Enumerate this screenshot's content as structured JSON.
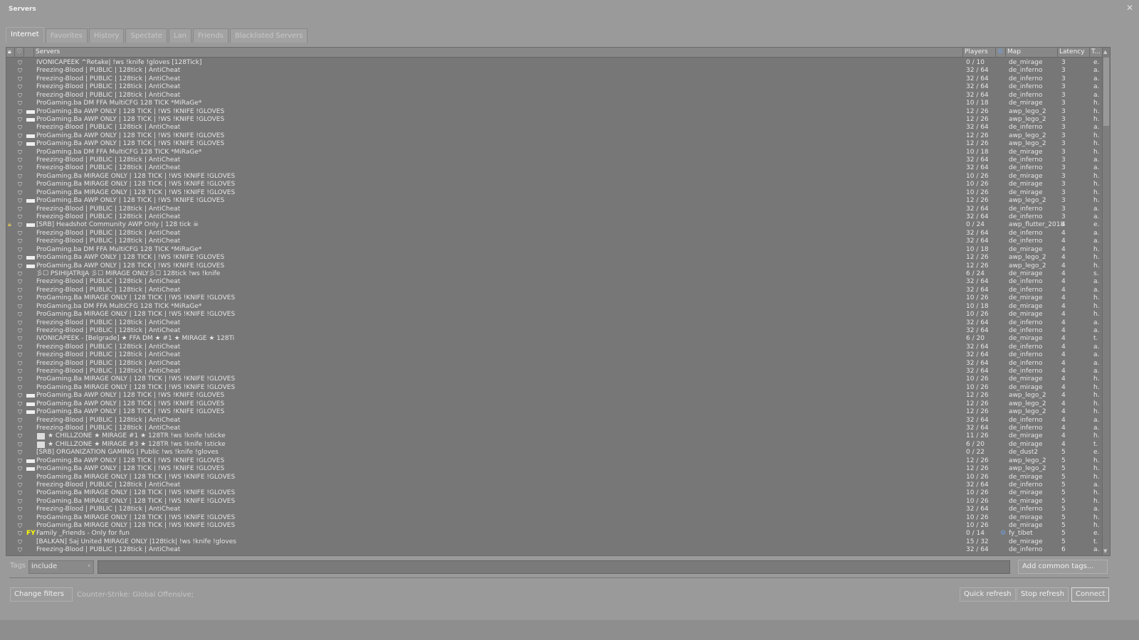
{
  "window": {
    "title": "Servers",
    "close_icon": "close-icon"
  },
  "tabs": [
    "Internet",
    "Favorites",
    "History",
    "Spectate",
    "Lan",
    "Friends",
    "Blacklisted Servers"
  ],
  "active_tab": "Internet",
  "columns": {
    "servers": "Servers",
    "players": "Players",
    "map": "Map",
    "latency": "Latency",
    "tags": "T..."
  },
  "rows": [
    [
      "",
      "IVONICAPEEK ^Retake| !ws !knife !gloves [128Tick]",
      "0 / 10",
      "de_mirage",
      "3",
      "e."
    ],
    [
      "",
      "Freezing-Blood | PUBLIC | 128tick | AntiCheat",
      "32 / 64",
      "de_inferno",
      "3",
      "a."
    ],
    [
      "",
      "Freezing-Blood | PUBLIC | 128tick | AntiCheat",
      "32 / 64",
      "de_inferno",
      "3",
      "a."
    ],
    [
      "",
      "Freezing-Blood | PUBLIC | 128tick | AntiCheat",
      "32 / 64",
      "de_inferno",
      "3",
      "a."
    ],
    [
      "",
      "Freezing-Blood | PUBLIC | 128tick | AntiCheat",
      "32 / 64",
      "de_inferno",
      "3",
      "a."
    ],
    [
      "",
      "ProGaming.ba DM FFA MultiCFG 128 TICK *MiRaGe*",
      "10 / 18",
      "de_mirage",
      "3",
      "h."
    ],
    [
      "awp",
      "ProGaming.Ba AWP ONLY | 128 TICK | !WS !KNIFE !GLOVES",
      "12 / 26",
      "awp_lego_2",
      "3",
      "h."
    ],
    [
      "awp",
      "ProGaming.Ba AWP ONLY | 128 TICK | !WS !KNIFE !GLOVES",
      "12 / 26",
      "awp_lego_2",
      "3",
      "h."
    ],
    [
      "",
      "Freezing-Blood | PUBLIC | 128tick | AntiCheat",
      "32 / 64",
      "de_inferno",
      "3",
      "a."
    ],
    [
      "awp",
      "ProGaming.Ba AWP ONLY | 128 TICK | !WS !KNIFE !GLOVES",
      "12 / 26",
      "awp_lego_2",
      "3",
      "h."
    ],
    [
      "awp",
      "ProGaming.Ba AWP ONLY | 128 TICK | !WS !KNIFE !GLOVES",
      "12 / 26",
      "awp_lego_2",
      "3",
      "h."
    ],
    [
      "",
      "ProGaming.ba DM FFA MultiCFG 128 TICK *MiRaGe*",
      "10 / 18",
      "de_mirage",
      "3",
      "h."
    ],
    [
      "",
      "Freezing-Blood | PUBLIC | 128tick | AntiCheat",
      "32 / 64",
      "de_inferno",
      "3",
      "a."
    ],
    [
      "",
      "Freezing-Blood | PUBLIC | 128tick | AntiCheat",
      "32 / 64",
      "de_inferno",
      "3",
      "a."
    ],
    [
      "",
      "ProGaming.Ba MIRAGE ONLY | 128 TICK | !WS !KNIFE !GLOVES",
      "10 / 26",
      "de_mirage",
      "3",
      "h."
    ],
    [
      "",
      "ProGaming.Ba MIRAGE ONLY | 128 TICK | !WS !KNIFE !GLOVES",
      "10 / 26",
      "de_mirage",
      "3",
      "h."
    ],
    [
      "",
      "ProGaming.Ba MIRAGE ONLY | 128 TICK | !WS !KNIFE !GLOVES",
      "10 / 26",
      "de_mirage",
      "3",
      "h."
    ],
    [
      "awp",
      "ProGaming.Ba AWP ONLY | 128 TICK | !WS !KNIFE !GLOVES",
      "12 / 26",
      "awp_lego_2",
      "3",
      "h."
    ],
    [
      "",
      "Freezing-Blood | PUBLIC | 128tick | AntiCheat",
      "32 / 64",
      "de_inferno",
      "3",
      "a."
    ],
    [
      "",
      "Freezing-Blood | PUBLIC | 128tick | AntiCheat",
      "32 / 64",
      "de_inferno",
      "3",
      "a."
    ],
    [
      "awp",
      "[SRB] Headshot Community AWP Only | 128 tick ☠",
      "0 / 24",
      "awp_flutter_2018",
      "4",
      "e.",
      "lock"
    ],
    [
      "",
      "Freezing-Blood | PUBLIC | 128tick | AntiCheat",
      "32 / 64",
      "de_inferno",
      "4",
      "a."
    ],
    [
      "",
      "Freezing-Blood | PUBLIC | 128tick | AntiCheat",
      "32 / 64",
      "de_inferno",
      "4",
      "a."
    ],
    [
      "",
      "ProGaming.ba DM FFA MultiCFG 128 TICK *MiRaGe*",
      "10 / 18",
      "de_mirage",
      "4",
      "h."
    ],
    [
      "awp",
      "ProGaming.Ba AWP ONLY | 128 TICK | !WS !KNIFE !GLOVES",
      "12 / 26",
      "awp_lego_2",
      "4",
      "h."
    ],
    [
      "awp",
      "ProGaming.Ba AWP ONLY | 128 TICK | !WS !KNIFE !GLOVES",
      "12 / 26",
      "awp_lego_2",
      "4",
      "h."
    ],
    [
      "",
      "彡☐ PSIHIJATRIJA 彡☐ MIRAGE ONLY彡☐ 128tick !ws !knife",
      "6 / 24",
      "de_mirage",
      "4",
      "s."
    ],
    [
      "",
      "Freezing-Blood | PUBLIC | 128tick | AntiCheat",
      "32 / 64",
      "de_inferno",
      "4",
      "a."
    ],
    [
      "",
      "Freezing-Blood | PUBLIC | 128tick | AntiCheat",
      "32 / 64",
      "de_inferno",
      "4",
      "a."
    ],
    [
      "",
      "ProGaming.Ba MIRAGE ONLY | 128 TICK | !WS !KNIFE !GLOVES",
      "10 / 26",
      "de_mirage",
      "4",
      "h."
    ],
    [
      "",
      "ProGaming.ba DM FFA MultiCFG 128 TICK *MiRaGe*",
      "10 / 18",
      "de_mirage",
      "4",
      "h."
    ],
    [
      "",
      "ProGaming.Ba MIRAGE ONLY | 128 TICK | !WS !KNIFE !GLOVES",
      "10 / 26",
      "de_mirage",
      "4",
      "h."
    ],
    [
      "",
      "Freezing-Blood | PUBLIC | 128tick | AntiCheat",
      "32 / 64",
      "de_inferno",
      "4",
      "a."
    ],
    [
      "",
      "Freezing-Blood | PUBLIC | 128tick | AntiCheat",
      "32 / 64",
      "de_inferno",
      "4",
      "a."
    ],
    [
      "",
      "IVONICAPEEK - [Belgrade] ★ FFA DM ★ #1 ★ MIRAGE ★ 128Ti",
      "6 / 20",
      "de_mirage",
      "4",
      "t."
    ],
    [
      "",
      "Freezing-Blood | PUBLIC | 128tick | AntiCheat",
      "32 / 64",
      "de_inferno",
      "4",
      "a."
    ],
    [
      "",
      "Freezing-Blood | PUBLIC | 128tick | AntiCheat",
      "32 / 64",
      "de_inferno",
      "4",
      "a."
    ],
    [
      "",
      "Freezing-Blood | PUBLIC | 128tick | AntiCheat",
      "32 / 64",
      "de_inferno",
      "4",
      "a."
    ],
    [
      "",
      "Freezing-Blood | PUBLIC | 128tick | AntiCheat",
      "32 / 64",
      "de_inferno",
      "4",
      "a."
    ],
    [
      "",
      "ProGaming.Ba MIRAGE ONLY | 128 TICK | !WS !KNIFE !GLOVES",
      "10 / 26",
      "de_mirage",
      "4",
      "h."
    ],
    [
      "",
      "ProGaming.Ba MIRAGE ONLY | 128 TICK | !WS !KNIFE !GLOVES",
      "10 / 26",
      "de_mirage",
      "4",
      "h."
    ],
    [
      "awp",
      "ProGaming.Ba AWP ONLY | 128 TICK | !WS !KNIFE !GLOVES",
      "12 / 26",
      "awp_lego_2",
      "4",
      "h."
    ],
    [
      "awp",
      "ProGaming.Ba AWP ONLY | 128 TICK | !WS !KNIFE !GLOVES",
      "12 / 26",
      "awp_lego_2",
      "4",
      "h."
    ],
    [
      "awp",
      "ProGaming.Ba AWP ONLY | 128 TICK | !WS !KNIFE !GLOVES",
      "12 / 26",
      "awp_lego_2",
      "4",
      "h."
    ],
    [
      "",
      "Freezing-Blood | PUBLIC | 128tick | AntiCheat",
      "32 / 64",
      "de_inferno",
      "4",
      "a."
    ],
    [
      "",
      "Freezing-Blood | PUBLIC | 128tick | AntiCheat",
      "32 / 64",
      "de_inferno",
      "4",
      "a."
    ],
    [
      "sq",
      "★ CHILLZONE ★ MIRAGE #1 ★ 128TR !ws !knife !sticke",
      "11 / 26",
      "de_mirage",
      "4",
      "h."
    ],
    [
      "sq",
      "★ CHILLZONE ★ MIRAGE #3 ★ 128TR !ws !knife !sticke",
      "6 / 20",
      "de_mirage",
      "4",
      "t."
    ],
    [
      "",
      "[SRB] ORGANIZATION GAMING | Public !ws !knife !gloves",
      "0 / 22",
      "de_dust2",
      "5",
      "e."
    ],
    [
      "awp",
      "ProGaming.Ba AWP ONLY | 128 TICK | !WS !KNIFE !GLOVES",
      "12 / 26",
      "awp_lego_2",
      "5",
      "h."
    ],
    [
      "awp",
      "ProGaming.Ba AWP ONLY | 128 TICK | !WS !KNIFE !GLOVES",
      "12 / 26",
      "awp_lego_2",
      "5",
      "h."
    ],
    [
      "",
      "ProGaming.Ba MIRAGE ONLY | 128 TICK | !WS !KNIFE !GLOVES",
      "10 / 26",
      "de_mirage",
      "5",
      "h."
    ],
    [
      "",
      "Freezing-Blood | PUBLIC | 128tick | AntiCheat",
      "32 / 64",
      "de_inferno",
      "5",
      "a."
    ],
    [
      "",
      "ProGaming.Ba MIRAGE ONLY | 128 TICK | !WS !KNIFE !GLOVES",
      "10 / 26",
      "de_mirage",
      "5",
      "h."
    ],
    [
      "",
      "ProGaming.Ba MIRAGE ONLY | 128 TICK | !WS !KNIFE !GLOVES",
      "10 / 26",
      "de_mirage",
      "5",
      "h."
    ],
    [
      "",
      "Freezing-Blood | PUBLIC | 128tick | AntiCheat",
      "32 / 64",
      "de_inferno",
      "5",
      "a."
    ],
    [
      "",
      "ProGaming.Ba MIRAGE ONLY | 128 TICK | !WS !KNIFE !GLOVES",
      "10 / 26",
      "de_mirage",
      "5",
      "h."
    ],
    [
      "",
      "ProGaming.Ba MIRAGE ONLY | 128 TICK | !WS !KNIFE !GLOVES",
      "10 / 26",
      "de_mirage",
      "5",
      "h."
    ],
    [
      "FY",
      "Family _Friends - Only for fun",
      "0 / 14",
      "fy_tibet",
      "5",
      "e.",
      "steam"
    ],
    [
      "",
      "[BALKAN] Saj United MIRAGE ONLY |128tick| !ws !knife !gloves",
      "15 / 32",
      "de_mirage",
      "5",
      "t."
    ],
    [
      "",
      "Freezing-Blood | PUBLIC | 128tick | AntiCheat",
      "32 / 64",
      "de_inferno",
      "6",
      "a."
    ]
  ],
  "filters": {
    "tags_label": "Tags",
    "tags_mode": "include",
    "tags_value": "",
    "add_common_tags": "Add common tags..."
  },
  "footer": {
    "change_filters": "Change filters",
    "game_filter": "Counter-Strike: Global Offensive;",
    "quick_refresh": "Quick refresh",
    "stop_refresh": "Stop refresh",
    "connect": "Connect"
  },
  "colors": {
    "lock": "#d8c060",
    "fy_badge": "#ffff00",
    "steam": "#6fa0e0"
  }
}
